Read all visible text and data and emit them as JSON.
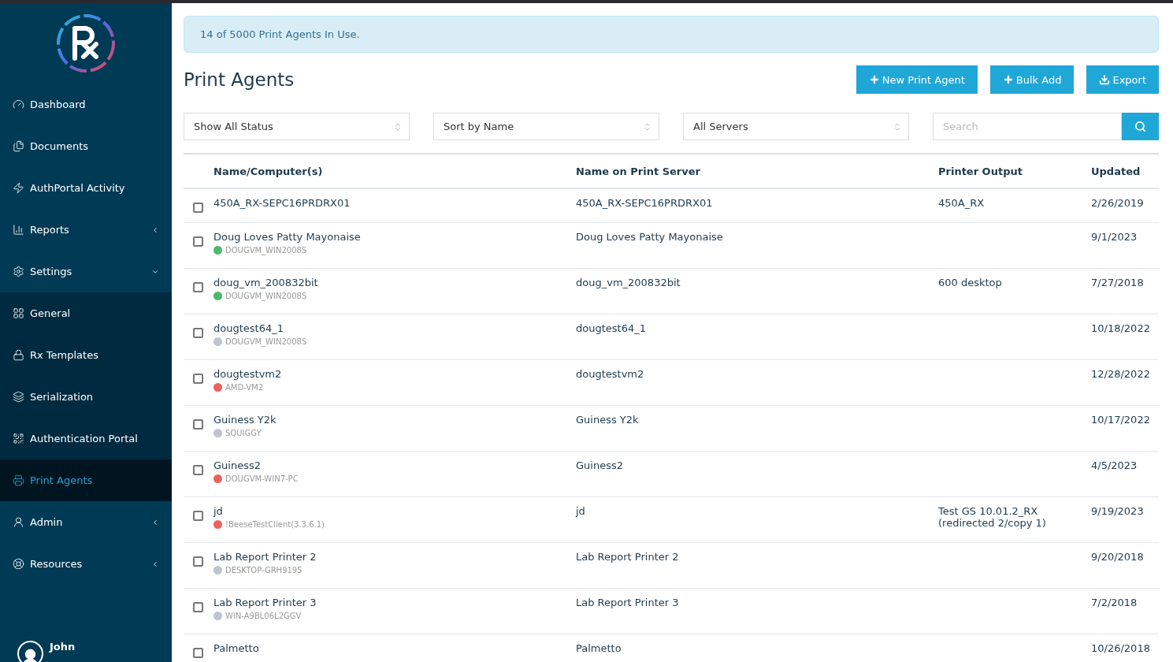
{
  "sidebar": {
    "items": [
      {
        "label": "Dashboard",
        "selected": false
      },
      {
        "label": "Documents",
        "selected": false
      },
      {
        "label": "AuthPortal Activity",
        "selected": false
      },
      {
        "label": "Reports",
        "selected": false,
        "expanded": false
      },
      {
        "label": "Settings",
        "selected": false,
        "expanded": true,
        "children": [
          {
            "label": "General",
            "selected": false
          },
          {
            "label": "Rx Templates",
            "selected": false
          },
          {
            "label": "Serialization",
            "selected": false
          },
          {
            "label": "Authentication Portal",
            "selected": false
          },
          {
            "label": "Print Agents",
            "selected": true
          }
        ]
      },
      {
        "label": "Admin",
        "selected": false,
        "expanded": false
      },
      {
        "label": "Resources",
        "selected": false,
        "expanded": false
      }
    ],
    "user": {
      "name": "John"
    }
  },
  "alert": "14 of 5000 Print Agents In Use.",
  "page_title": "Print Agents",
  "buttons": [
    {
      "label": "New Print Agent",
      "kind": "plus"
    },
    {
      "label": "Bulk Add",
      "kind": "plus"
    },
    {
      "label": "Export",
      "kind": "download"
    }
  ],
  "filters": [
    {
      "value": "Show All Status"
    },
    {
      "value": "Sort by Name"
    },
    {
      "value": "All Servers"
    }
  ],
  "search": {
    "placeholder": "Search"
  },
  "table": {
    "columns": [
      "Name/Computer(s)",
      "Name on Print Server",
      "Printer Output",
      "Updated"
    ],
    "rows": [
      {
        "checked": false,
        "name": "450A_RX-SEPC16PRDRX01",
        "server_name": "450A_RX-SEPC16PRDRX01",
        "output": "450A_RX",
        "updated": "2/26/2019"
      },
      {
        "checked": false,
        "name": "Doug Loves Patty Mayonaise",
        "computer": "DOUGVM_WIN2008S",
        "color": "#48bb6a",
        "server_name": "Doug Loves Patty Mayonaise",
        "updated": "9/1/2023"
      },
      {
        "checked": false,
        "name": "doug_vm_200832bit",
        "computer": "DOUGVM_WIN2008S",
        "color": "#48bb6a",
        "server_name": "doug_vm_200832bit",
        "output": "600 desktop",
        "updated": "7/27/2018"
      },
      {
        "checked": false,
        "name": "dougtest64_1",
        "computer": "DOUGVM_WIN2008S",
        "color": "#bfc4ce",
        "server_name": "dougtest64_1",
        "updated": "10/18/2022"
      },
      {
        "checked": false,
        "name": "dougtestvm2",
        "computer": "AMD-VM2",
        "color": "#f0605d",
        "server_name": "dougtestvm2",
        "updated": "12/28/2022"
      },
      {
        "checked": false,
        "name": "Guiness Y2k",
        "computer": "SQUIGGY",
        "color": "#bfc4ce",
        "server_name": "Guiness Y2k",
        "updated": "10/17/2022"
      },
      {
        "checked": false,
        "name": "Guiness2",
        "computer": "DOUGVM-WIN7-PC",
        "color": "#f0605d",
        "server_name": "Guiness2",
        "updated": "4/5/2023"
      },
      {
        "checked": false,
        "name": "jd",
        "computer": "!BeeseTestClient(3.3.6.1)",
        "color": "#f0605d",
        "server_name": "jd",
        "output": "Test GS 10.01.2_RX\n(redirected 2/copy 1)",
        "updated": "9/19/2023"
      },
      {
        "checked": false,
        "name": "Lab Report Printer 2",
        "computer": "DESKTOP-GRH9195",
        "color": "#bfc4ce",
        "server_name": "Lab Report Printer 2",
        "updated": "9/20/2018"
      },
      {
        "checked": false,
        "name": "Lab Report Printer 3",
        "computer": "WIN-A9BL06L2GGV",
        "color": "#bfc4ce",
        "server_name": "Lab Report Printer 3",
        "updated": "7/2/2018"
      },
      {
        "checked": false,
        "name": "Palmetto",
        "server_name": "Palmetto",
        "updated": "10/26/2018"
      }
    ]
  }
}
